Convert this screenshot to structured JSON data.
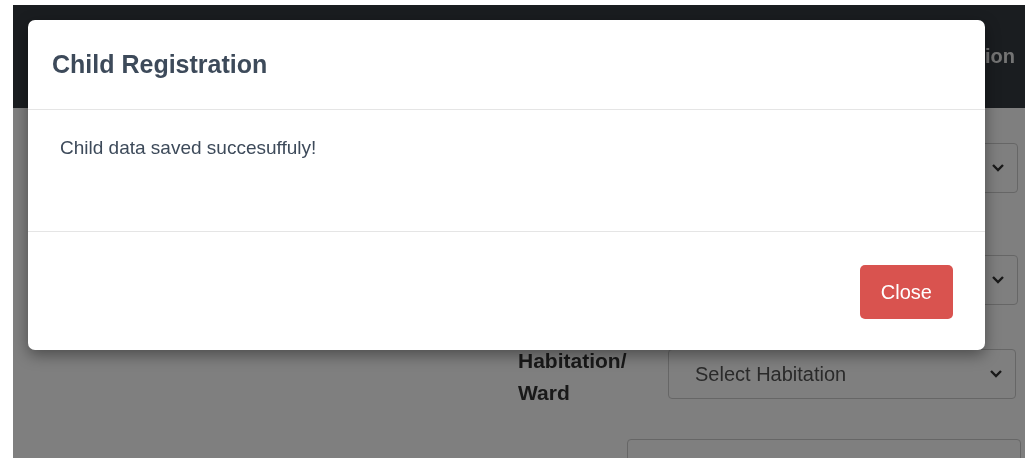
{
  "background_page": {
    "navbar_text": "ion",
    "habitation_field": {
      "label": "Habitation/ Ward",
      "placeholder": "Select Habitation"
    }
  },
  "modal": {
    "title": "Child Registration",
    "message": "Child data saved succesuffuly!",
    "buttons": [
      {
        "label": "Close",
        "kind": "danger"
      }
    ]
  }
}
